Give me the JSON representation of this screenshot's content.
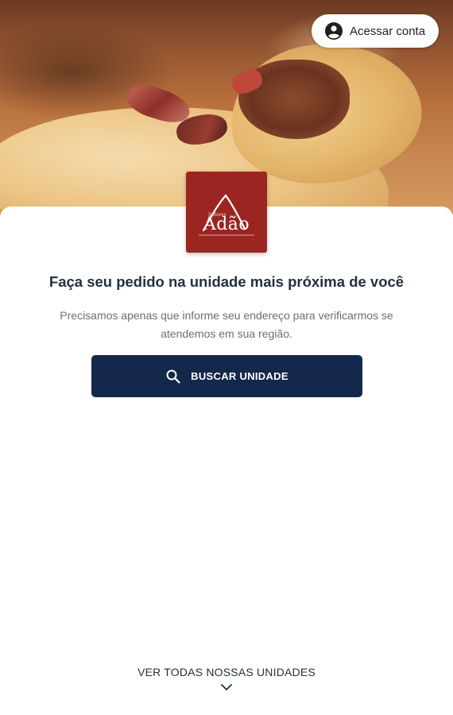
{
  "header": {
    "account_label": "Acessar conta",
    "account_icon": "account-circle-icon"
  },
  "brand": {
    "logo_small_text": "Sabores",
    "logo_text": "Adão",
    "logo_color": "#9b2521"
  },
  "main": {
    "headline": "Faça seu pedido na unidade mais próxima de você",
    "description": "Precisamos apenas que informe seu endereço para verificarmos se atendemos em sua região.",
    "search_button_label": "BUSCAR UNIDADE",
    "search_icon": "search-icon",
    "accent_color": "#13284a"
  },
  "footer": {
    "all_units_label": "VER TODAS NOSSAS UNIDADES",
    "chevron_icon": "chevron-down-icon"
  }
}
